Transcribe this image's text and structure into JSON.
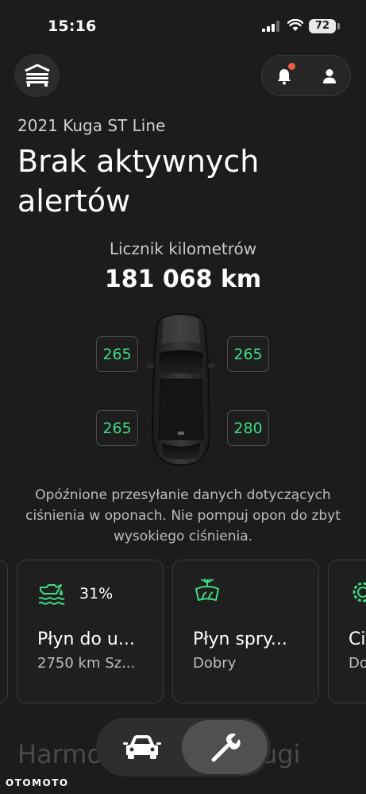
{
  "status_bar": {
    "time": "15:16",
    "battery": "72"
  },
  "header": {
    "vehicle": "2021 Kuga ST Line",
    "title": "Brak aktywnych alertów"
  },
  "odometer": {
    "label": "Licznik kilometrów",
    "value": "181 068 km"
  },
  "tires": {
    "front_left": "265",
    "front_right": "265",
    "rear_left": "265",
    "rear_right": "280"
  },
  "tire_note": "Opóźnione przesyłanie danych dotyczących ciśnienia w oponach. Nie pompuj opon do zbyt wysokiego ciśnienia.",
  "cards": [
    {
      "badge": "31%",
      "title": "Płyn do u...",
      "subtitle": "2750 km Sz..."
    },
    {
      "title": "Płyn spry...",
      "subtitle": "Dobry"
    },
    {
      "title": "Ci",
      "subtitle": "Do"
    }
  ],
  "schedule_heading": "Harmonogram obsługi",
  "watermark": "OTOMOTO",
  "colors": {
    "accent": "#3ddc84",
    "alert_dot": "#f05a4a",
    "background": "#1c1c1c"
  }
}
